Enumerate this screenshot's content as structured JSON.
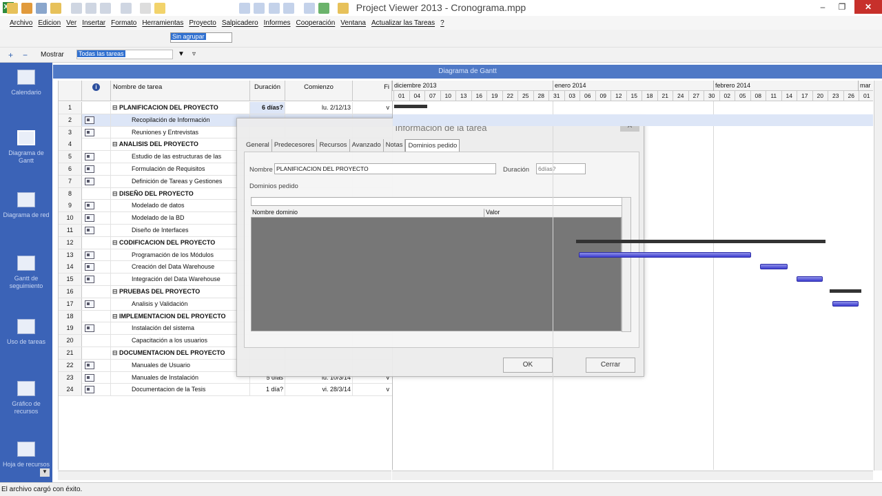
{
  "window": {
    "title": "Project Viewer 2013 - Cronograma.mpp",
    "app_icon": "XV"
  },
  "menu": [
    "Archivo",
    "Edicion",
    "Ver",
    "Insertar",
    "Formato",
    "Herramientas",
    "Proyecto",
    "Salpicadero",
    "Informes",
    "Cooperación",
    "Ventana",
    "Actualizar las Tareas",
    "?"
  ],
  "toolbar": {
    "group_value": "Sin agrupar",
    "show_label": "Mostrar",
    "filter_value": "Todas las tareas"
  },
  "views": [
    "Calendario",
    "Diagrama de Gantt",
    "Diagrama de red",
    "Gantt de seguimiento",
    "Uso de tareas",
    "Gráfico de recursos",
    "Hoja de recursos"
  ],
  "gantt_header": "Diagrama de Gantt",
  "grid": {
    "headers": {
      "id": "",
      "name": "Nombre de tarea",
      "duration": "Duración",
      "start": "Comienzo",
      "finish": "Fi"
    },
    "rows": [
      {
        "id": "1",
        "name": "PLANIFICACION DEL PROYECTO",
        "dur": "6 días?",
        "start": "lu. 2/12/13",
        "fin": "v",
        "summary": true,
        "icon": false
      },
      {
        "id": "2",
        "name": "Recopilación de Información",
        "dur": "",
        "start": "",
        "fin": "",
        "summary": false,
        "icon": true
      },
      {
        "id": "3",
        "name": "Reuniones y Entrevistas",
        "dur": "",
        "start": "",
        "fin": "",
        "summary": false,
        "icon": true
      },
      {
        "id": "4",
        "name": "ANALISIS DEL PROYECTO",
        "dur": "",
        "start": "",
        "fin": "",
        "summary": true,
        "icon": false
      },
      {
        "id": "5",
        "name": "Estudio de las estructuras de las",
        "dur": "",
        "start": "",
        "fin": "",
        "summary": false,
        "icon": true
      },
      {
        "id": "6",
        "name": "Formulación de Requisitos",
        "dur": "",
        "start": "",
        "fin": "",
        "summary": false,
        "icon": true
      },
      {
        "id": "7",
        "name": "Definición de Tareas y Gestiones",
        "dur": "",
        "start": "",
        "fin": "",
        "summary": false,
        "icon": true
      },
      {
        "id": "8",
        "name": "DISEÑO DEL PROYECTO",
        "dur": "",
        "start": "",
        "fin": "",
        "summary": true,
        "icon": false
      },
      {
        "id": "9",
        "name": "Modelado de datos",
        "dur": "",
        "start": "",
        "fin": "",
        "summary": false,
        "icon": true
      },
      {
        "id": "10",
        "name": "Modelado de la BD",
        "dur": "",
        "start": "",
        "fin": "",
        "summary": false,
        "icon": true
      },
      {
        "id": "11",
        "name": "Diseño de Interfaces",
        "dur": "",
        "start": "",
        "fin": "",
        "summary": false,
        "icon": true
      },
      {
        "id": "12",
        "name": "CODIFICACION DEL PROYECTO",
        "dur": "",
        "start": "",
        "fin": "",
        "summary": true,
        "icon": false
      },
      {
        "id": "13",
        "name": "Programación de los Módulos",
        "dur": "",
        "start": "",
        "fin": "",
        "summary": false,
        "icon": true
      },
      {
        "id": "14",
        "name": "Creación del Data Warehouse",
        "dur": "",
        "start": "",
        "fin": "",
        "summary": false,
        "icon": true
      },
      {
        "id": "15",
        "name": "Integración del Data Warehouse",
        "dur": "",
        "start": "",
        "fin": "",
        "summary": false,
        "icon": true
      },
      {
        "id": "16",
        "name": "PRUEBAS DEL PROYECTO",
        "dur": "",
        "start": "",
        "fin": "",
        "summary": true,
        "icon": false
      },
      {
        "id": "17",
        "name": "Analisis y Validación",
        "dur": "",
        "start": "",
        "fin": "",
        "summary": false,
        "icon": true
      },
      {
        "id": "18",
        "name": "IMPLEMENTACION DEL PROYECTO",
        "dur": "",
        "start": "",
        "fin": "",
        "summary": true,
        "icon": false
      },
      {
        "id": "19",
        "name": "Instalación del sistema",
        "dur": "",
        "start": "",
        "fin": "",
        "summary": false,
        "icon": true
      },
      {
        "id": "20",
        "name": "Capacitación a los usuarios",
        "dur": "",
        "start": "",
        "fin": "",
        "summary": false,
        "icon": false
      },
      {
        "id": "21",
        "name": "DOCUMENTACION DEL PROYECTO",
        "dur": "",
        "start": "",
        "fin": "",
        "summary": true,
        "icon": false
      },
      {
        "id": "22",
        "name": "Manuales de Usuario",
        "dur": "",
        "start": "",
        "fin": "",
        "summary": false,
        "icon": true
      },
      {
        "id": "23",
        "name": "Manuales de Instalación",
        "dur": "5 días",
        "start": "lu. 10/3/14",
        "fin": "v",
        "summary": false,
        "icon": true
      },
      {
        "id": "24",
        "name": "Documentacion de la Tesis",
        "dur": "1 día?",
        "start": "vi. 28/3/14",
        "fin": "v",
        "summary": false,
        "icon": true
      }
    ]
  },
  "timescale": {
    "months": [
      "diciembre 2013",
      "enero 2014",
      "febrero 2014",
      "mar"
    ],
    "days": [
      "01",
      "04",
      "07",
      "10",
      "13",
      "16",
      "19",
      "22",
      "25",
      "28",
      "31",
      "03",
      "06",
      "09",
      "12",
      "15",
      "18",
      "21",
      "24",
      "27",
      "30",
      "02",
      "05",
      "08",
      "11",
      "14",
      "17",
      "20",
      "23",
      "26",
      "01"
    ]
  },
  "dialog": {
    "title": "Informacion de la tarea",
    "tabs": [
      "General",
      "Predecesores",
      "Recursos",
      "Avanzado",
      "Notas",
      "Dominios pedido"
    ],
    "name_label": "Nombre",
    "name_value": "PLANIFICACION DEL PROYECTO",
    "duration_label": "Duración",
    "duration_value": "6días?",
    "domains_label": "Dominios pedido",
    "col_domain": "Nombre dominio",
    "col_value": "Valor",
    "ok": "OK",
    "cancel": "Cerrar"
  },
  "status": "El archivo cargó con éxito."
}
